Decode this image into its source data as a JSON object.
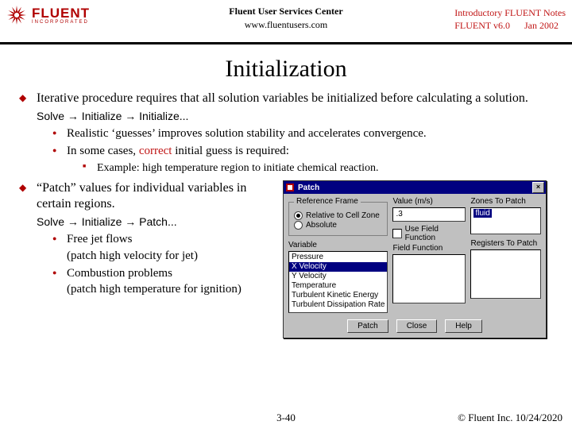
{
  "header": {
    "logo_main": "FLUENT",
    "logo_sub": "INCORPORATED",
    "center_line1": "Fluent User Services Center",
    "center_line2": "www.fluentusers.com",
    "right_line1": "Introductory FLUENT Notes",
    "right_line2a": "FLUENT v6.0",
    "right_line2b": "Jan 2002"
  },
  "title": "Initialization",
  "b1": {
    "intro": "Iterative procedure requires that all solution variables be initialized before calculating a solution.",
    "path": "Solve → Initialize → Initialize...",
    "s1": "Realistic ‘guesses’ improves solution stability and accelerates convergence.",
    "s2a": "In some cases, ",
    "s2b": "correct",
    "s2c": " initial guess is required:",
    "ex": "Example: high temperature region to initiate chemical reaction."
  },
  "b2": {
    "intro": "“Patch” values for individual variables in certain regions.",
    "path": "Solve → Initialize → Patch...",
    "s1": "Free jet flows\n(patch high velocity for jet)",
    "s2": "Combustion problems\n(patch high temperature for ignition)"
  },
  "dialog": {
    "title": "Patch",
    "ref_frame": "Reference Frame",
    "rf1": "Relative to Cell Zone",
    "rf2": "Absolute",
    "value_label": "Value (m/s)",
    "value": ".3",
    "zones_label": "Zones To Patch",
    "zone_item": "fluid",
    "use_ff": "Use Field Function",
    "ff_label": "Field Function",
    "reg_label": "Registers To Patch",
    "var_label": "Variable",
    "vars": [
      "Pressure",
      "X Velocity",
      "Y Velocity",
      "Temperature",
      "Turbulent Kinetic Energy",
      "Turbulent Dissipation Rate"
    ],
    "var_selected": 1,
    "btn1": "Patch",
    "btn2": "Close",
    "btn3": "Help"
  },
  "footer": {
    "center": "3-40",
    "right": "© Fluent Inc. 10/24/2020"
  }
}
